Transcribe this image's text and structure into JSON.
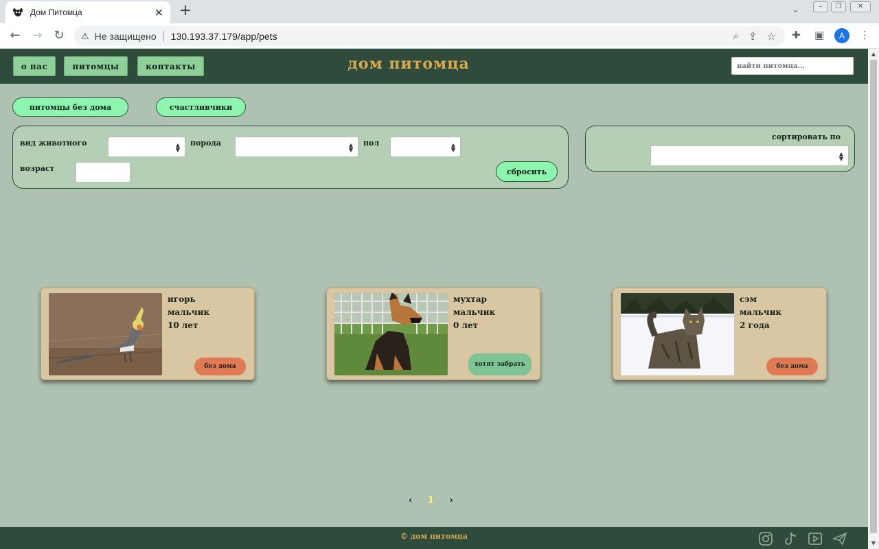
{
  "browser": {
    "tab_title": "Дом Питомца",
    "new_tab": "+",
    "security_label": "Не защищено",
    "url": "130.193.37.179/app/pets",
    "profile_initial": "A"
  },
  "header": {
    "nav": [
      "о нас",
      "питомцы",
      "контакты"
    ],
    "title": "дом питомца",
    "search_placeholder": "найти питомца..."
  },
  "tabs": [
    "питомцы без дома",
    "счастливчики"
  ],
  "filters": {
    "species_label": "вид животного",
    "breed_label": "порода",
    "sex_label": "пол",
    "age_label": "возраст",
    "reset_label": "сбросить"
  },
  "sort": {
    "label": "сортировать по"
  },
  "pets": [
    {
      "name": "игорь",
      "sex": "мальчик",
      "age": "10 лет",
      "status": "без дома"
    },
    {
      "name": "мухтар",
      "sex": "мальчик",
      "age": "0 лет",
      "status": "хотят забрать"
    },
    {
      "name": "сэм",
      "sex": "мальчик",
      "age": "2 года",
      "status": "без дома"
    }
  ],
  "pagination": {
    "prev": "‹",
    "current": "1",
    "next": "›"
  },
  "footer": {
    "copyright": "© дом питомца"
  },
  "colors": {
    "header_bg": "#2f4b3b",
    "page_bg": "#afc1b1",
    "accent_gold": "#d9a94e",
    "pill_green": "#8ef5b0",
    "status_orange": "#e07a55",
    "status_green": "#7ec394"
  }
}
